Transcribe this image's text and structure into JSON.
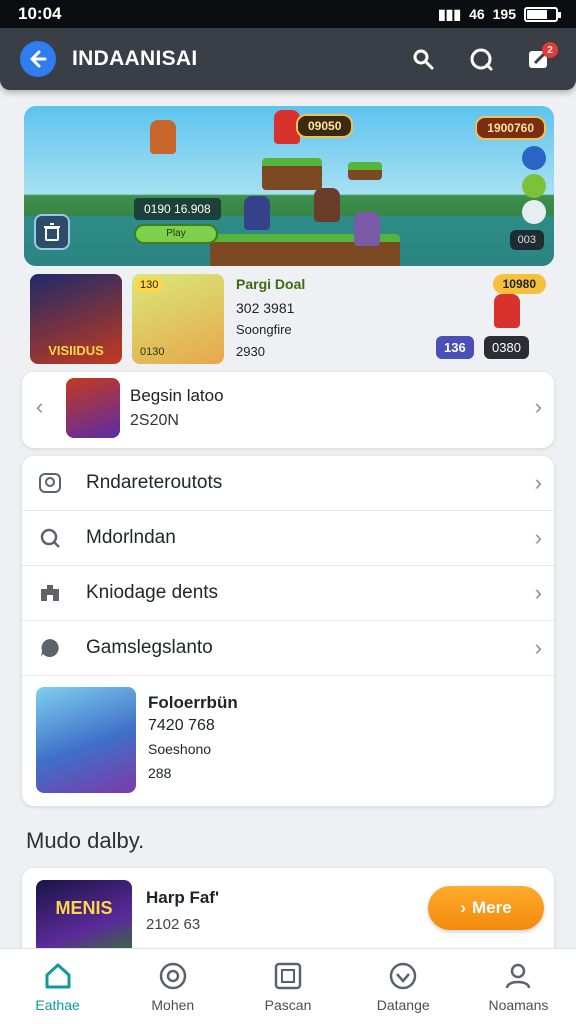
{
  "status_bar": {
    "time": "10:04",
    "signal": "46",
    "battery": "195",
    "battery_level": 0.7
  },
  "app_bar": {
    "title": "INDAANISAI",
    "notification_count": "2"
  },
  "hero": {
    "score_pill": "09050",
    "coins_pill": "1900760",
    "info_text": "0190 16.908",
    "play_label": "Play",
    "badge": "003"
  },
  "thumbs_row": {
    "thumb1_label": "VISIIDUS",
    "thumb2_badge": "130",
    "thumb2_footer": "0130",
    "game_title": "Pargi Doal",
    "game_sub": "302 3981",
    "game_tag": "Soongfire",
    "game_rating": "2930",
    "right_pill": "10980",
    "badge_left": "136",
    "badge_right": "0380"
  },
  "featured": {
    "title": "Begsin latoo",
    "sub": "2S20N"
  },
  "list": {
    "items": [
      {
        "label": "Rndareteroutots",
        "icon": "user-settings-icon"
      },
      {
        "label": "Mdorlndan",
        "icon": "search-gear-icon"
      },
      {
        "label": "Kniodage dents",
        "icon": "people-icon"
      },
      {
        "label": "Gamslegslanto",
        "icon": "chat-icon"
      }
    ],
    "promo": {
      "title": "Foloerrbün",
      "sub": "7420 768",
      "tags": "Soeshono",
      "rating": "288"
    }
  },
  "section_title": "Mudo dalby.",
  "bottom_card": {
    "title": "Harp Faf'",
    "sub": "2102 63",
    "thumb_label": "MENIS",
    "more_label": "Mere"
  },
  "nav": [
    {
      "label": "Eathae",
      "icon": "home-icon",
      "active": true
    },
    {
      "label": "Mohen",
      "icon": "circle-icon",
      "active": false
    },
    {
      "label": "Pascan",
      "icon": "square-icon",
      "active": false
    },
    {
      "label": "Datange",
      "icon": "shield-icon",
      "active": false
    },
    {
      "label": "Noamans",
      "icon": "person-icon",
      "active": false
    }
  ]
}
